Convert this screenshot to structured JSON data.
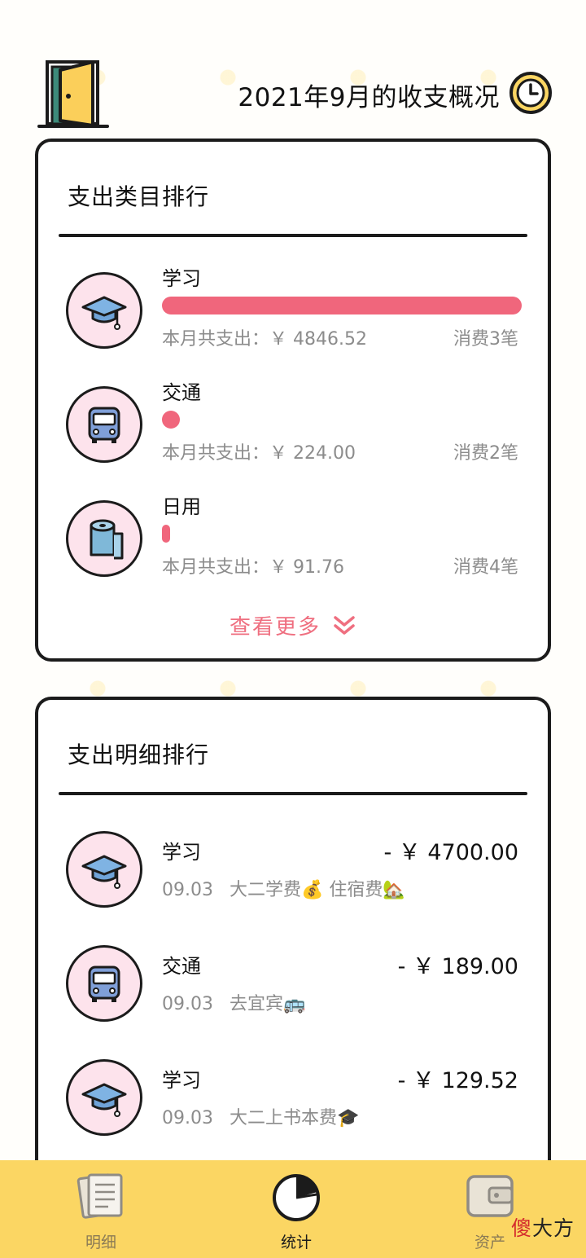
{
  "header": {
    "title": "2021年9月的收支概况"
  },
  "category_card": {
    "title": "支出类目排行",
    "items": [
      {
        "name": "学习",
        "icon": "graduation-cap-icon",
        "share": 1.0,
        "amount": "本月共支出：￥ 4846.52",
        "count": "消费3笔"
      },
      {
        "name": "交通",
        "icon": "bus-icon",
        "share": 0.046,
        "amount": "本月共支出：￥ 224.00",
        "count": "消费2笔"
      },
      {
        "name": "日用",
        "icon": "toilet-paper-icon",
        "share": 0.019,
        "amount": "本月共支出：￥ 91.76",
        "count": "消费4笔"
      }
    ],
    "more_label": "查看更多"
  },
  "detail_card": {
    "title": "支出明细排行",
    "items": [
      {
        "category": "学习",
        "icon": "graduation-cap-icon",
        "amount": "- ￥ 4700.00",
        "date": "09.03",
        "note": "大二学费💰 住宿费🏡"
      },
      {
        "category": "交通",
        "icon": "bus-icon",
        "amount": "- ￥ 189.00",
        "date": "09.03",
        "note": "去宜宾🚌"
      },
      {
        "category": "学习",
        "icon": "graduation-cap-icon",
        "amount": "- ￥ 129.52",
        "date": "09.03",
        "note": "大二上书本费🎓"
      }
    ]
  },
  "tabbar": {
    "tabs": [
      {
        "label": "明细",
        "icon": "notes-icon",
        "active": false
      },
      {
        "label": "统计",
        "icon": "pie-chart-icon",
        "active": true
      },
      {
        "label": "资产",
        "icon": "wallet-icon",
        "active": false
      }
    ]
  },
  "watermark": {
    "first": "傻",
    "rest": "大方"
  },
  "colors": {
    "accent_pink": "#f0667c",
    "tabbar_yellow": "#fbd663",
    "icon_circle_bg": "#fde3ec",
    "outline": "#1b1b1b"
  }
}
